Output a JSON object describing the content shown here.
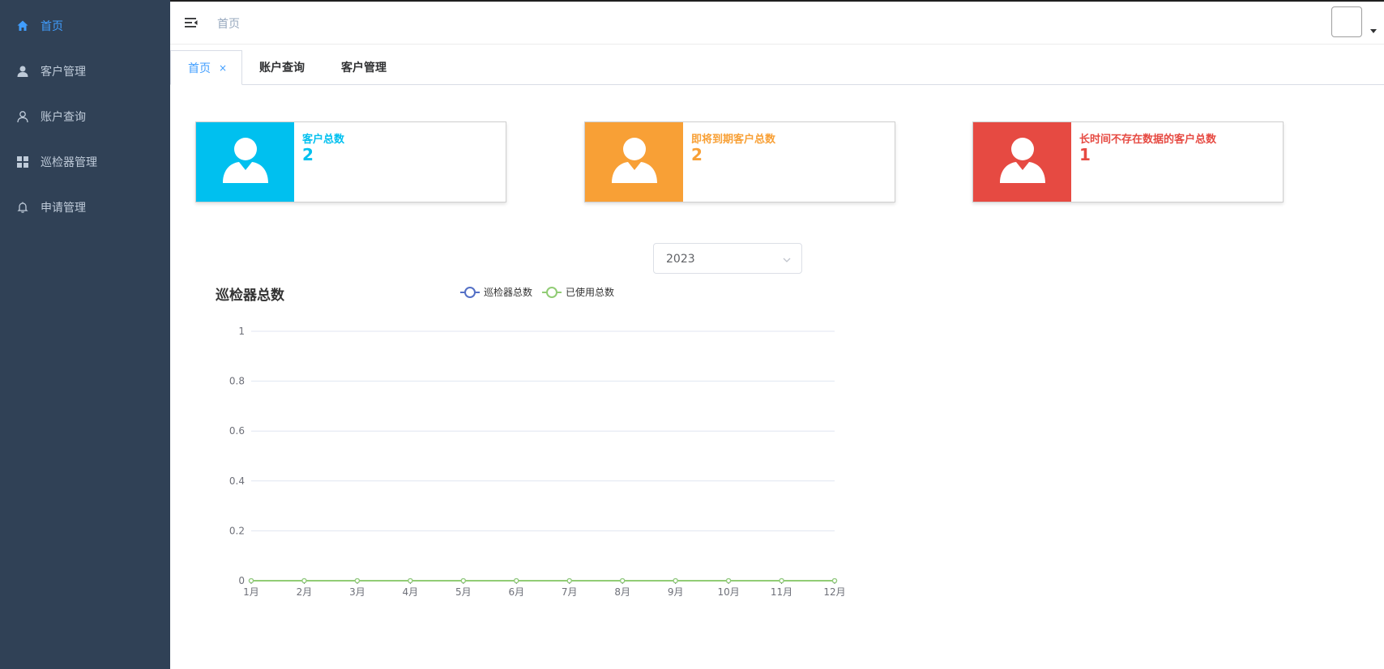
{
  "sidebar": {
    "items": [
      {
        "label": "首页",
        "icon": "home-icon"
      },
      {
        "label": "客户管理",
        "icon": "user-filled-icon"
      },
      {
        "label": "账户查询",
        "icon": "user-outline-icon"
      },
      {
        "label": "巡检器管理",
        "icon": "grid-icon"
      },
      {
        "label": "申请管理",
        "icon": "bell-icon"
      }
    ],
    "background": "#304156",
    "active_color": "#409eff"
  },
  "header": {
    "breadcrumb": "首页"
  },
  "tabs": [
    {
      "label": "首页",
      "active": true,
      "closable": true,
      "close_glyph": "×"
    },
    {
      "label": "账户查询",
      "active": false
    },
    {
      "label": "客户管理",
      "active": false
    }
  ],
  "cards": [
    {
      "title": "客户总数",
      "value": "2",
      "color": "#00c0ef"
    },
    {
      "title": "即将到期客户总数",
      "value": "2",
      "color": "#f8a036"
    },
    {
      "title": "长时间不存在数据的客户总数",
      "value": "1",
      "color": "#e64a42"
    }
  ],
  "year_select": {
    "value": "2023"
  },
  "chart_data": {
    "type": "line",
    "title": "巡检器总数",
    "categories": [
      "1月",
      "2月",
      "3月",
      "4月",
      "5月",
      "6月",
      "7月",
      "8月",
      "9月",
      "10月",
      "11月",
      "12月"
    ],
    "series": [
      {
        "name": "巡检器总数",
        "values": [
          0,
          0,
          0,
          0,
          0,
          0,
          0,
          0,
          0,
          0,
          0,
          0
        ],
        "color": "#5470c6"
      },
      {
        "name": "已使用总数",
        "values": [
          0,
          0,
          0,
          0,
          0,
          0,
          0,
          0,
          0,
          0,
          0,
          0
        ],
        "color": "#91cc75"
      }
    ],
    "ylim": [
      0,
      1
    ],
    "yticks": [
      "0",
      "0.2",
      "0.4",
      "0.6",
      "0.8",
      "1"
    ],
    "grid": true,
    "legend": "top"
  }
}
